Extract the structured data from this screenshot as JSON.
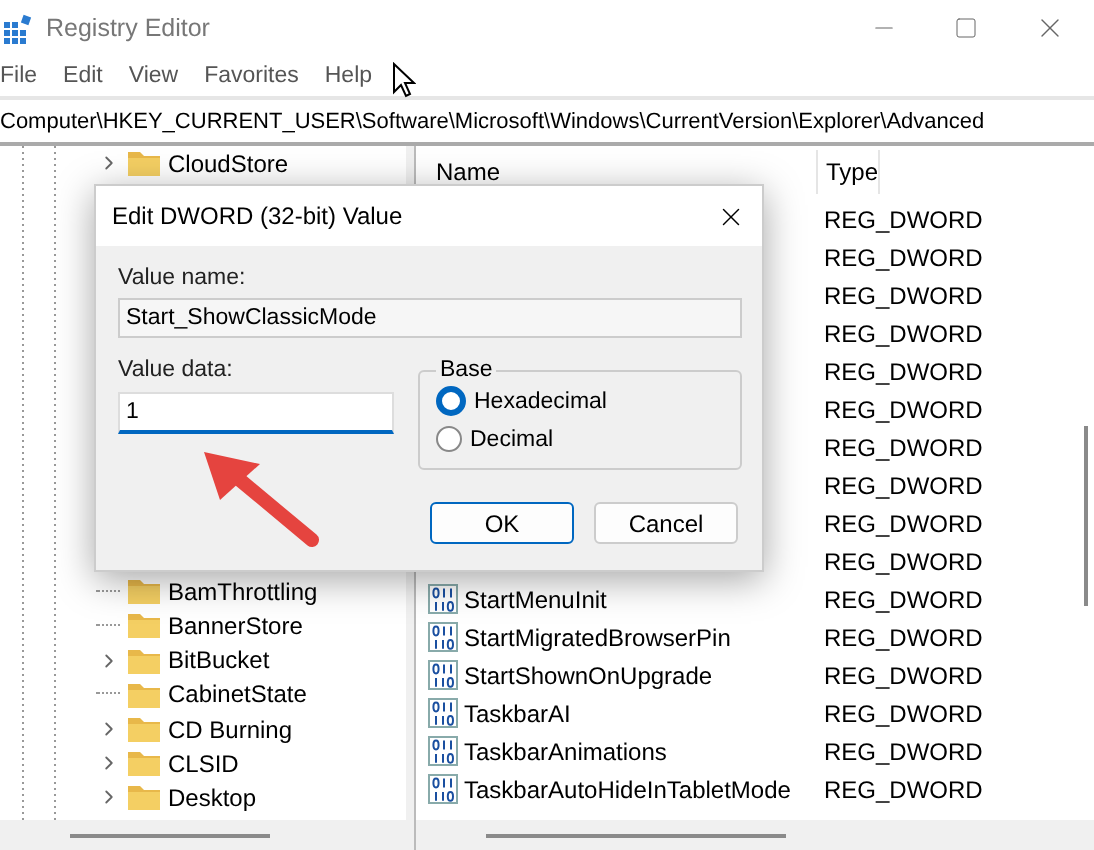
{
  "window": {
    "title": "Registry Editor"
  },
  "menu": [
    "File",
    "Edit",
    "View",
    "Favorites",
    "Help"
  ],
  "address": "Computer\\HKEY_CURRENT_USER\\Software\\Microsoft\\Windows\\CurrentVersion\\Explorer\\Advanced",
  "tree": {
    "top_items": [
      {
        "label": "CloudStore",
        "expandable": true
      }
    ],
    "items": [
      {
        "label": "BamThrottling",
        "expandable": false
      },
      {
        "label": "BannerStore",
        "expandable": false
      },
      {
        "label": "BitBucket",
        "expandable": true
      },
      {
        "label": "CabinetState",
        "expandable": false
      },
      {
        "label": "CD Burning",
        "expandable": true
      },
      {
        "label": "CLSID",
        "expandable": true
      },
      {
        "label": "Desktop",
        "expandable": true
      }
    ]
  },
  "list": {
    "columns": [
      "Name",
      "Type"
    ],
    "rows": [
      {
        "type": "REG_DWORD"
      },
      {
        "type": "REG_DWORD"
      },
      {
        "type": "REG_DWORD"
      },
      {
        "type": "REG_DWORD"
      },
      {
        "type": "REG_DWORD"
      },
      {
        "type": "REG_DWORD"
      },
      {
        "type": "REG_DWORD"
      },
      {
        "type": "REG_DWORD"
      },
      {
        "type": "REG_DWORD"
      },
      {
        "type": "REG_DWORD"
      },
      {
        "name": "StartMenuInit",
        "type": "REG_DWORD"
      },
      {
        "name": "StartMigratedBrowserPin",
        "type": "REG_DWORD"
      },
      {
        "name": "StartShownOnUpgrade",
        "type": "REG_DWORD"
      },
      {
        "name": "TaskbarAI",
        "type": "REG_DWORD"
      },
      {
        "name": "TaskbarAnimations",
        "type": "REG_DWORD"
      },
      {
        "name": "TaskbarAutoHideInTabletMode",
        "type": "REG_DWORD"
      }
    ]
  },
  "dialog": {
    "title": "Edit DWORD (32-bit) Value",
    "value_name_label": "Value name:",
    "value_name": "Start_ShowClassicMode",
    "value_data_label": "Value data:",
    "value_data": "1",
    "base_label": "Base",
    "base_options": [
      {
        "label": "Hexadecimal",
        "selected": true
      },
      {
        "label": "Decimal",
        "selected": false
      }
    ],
    "buttons": [
      {
        "label": "OK",
        "default": true
      },
      {
        "label": "Cancel",
        "default": false
      }
    ]
  }
}
